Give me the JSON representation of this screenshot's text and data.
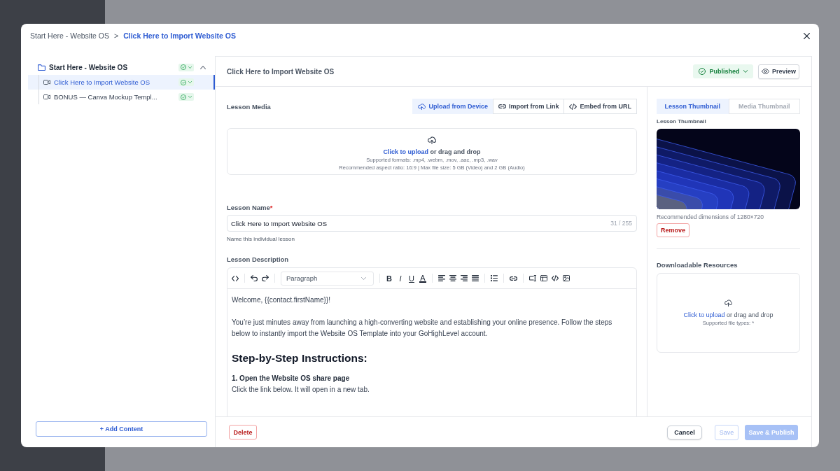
{
  "breadcrumb": {
    "separator": ">",
    "items": [
      {
        "label": "Start Here - Website OS",
        "current": false
      },
      {
        "label": "Click Here to Import Website OS",
        "current": true
      }
    ]
  },
  "sidebar": {
    "items": [
      {
        "label": "Start Here - Website OS",
        "published": true,
        "expanded": true,
        "children": [
          {
            "label": "Click Here to Import Website OS",
            "published": true,
            "selected": true
          },
          {
            "label": "BONUS — Canva Mockup Templ...",
            "published": true,
            "selected": false
          }
        ]
      }
    ],
    "add_button": "+ Add Content"
  },
  "lesson_header": {
    "title": "Click Here to Import Website OS",
    "status": {
      "label": "Published",
      "published": true
    },
    "preview_button": "Preview"
  },
  "media": {
    "label": "Lesson Media",
    "tabs": [
      {
        "kind": "upload",
        "label": "Upload from Device",
        "selected": true
      },
      {
        "kind": "link",
        "label": "Import from Link",
        "selected": false
      },
      {
        "kind": "embed",
        "label": "Embed from URL",
        "selected": false
      }
    ],
    "dropzone": {
      "link": "Click to upload",
      "text": "or drag and drop",
      "formats": "Supported formats: .mp4, .webm, .mov, .aac, .mp3, .wav",
      "limits": "Recommended aspect ratio: 16:9 | Max file size: 5 GB (Video) and 2 GB (Audio)"
    }
  },
  "lesson_name": {
    "label": "Lesson Name",
    "required_mark": "*",
    "value": "Click Here to Import Website OS",
    "counter": "31 / 255",
    "help": "Name this individual lesson"
  },
  "description": {
    "label": "Lesson Description",
    "toolbar": {
      "groups": [
        {
          "items": [
            {
              "kind": "code-view"
            }
          ]
        },
        {
          "items": [
            {
              "kind": "undo"
            },
            {
              "kind": "redo"
            }
          ]
        },
        {
          "items": [
            {
              "kind": "block-format",
              "value": "Paragraph"
            }
          ]
        },
        {
          "items": [
            {
              "kind": "bold",
              "label": "B"
            },
            {
              "kind": "italic",
              "label": "I"
            },
            {
              "kind": "underline",
              "label": "U"
            },
            {
              "kind": "text-color",
              "label": "A"
            }
          ]
        },
        {
          "items": [
            {
              "kind": "align-left"
            },
            {
              "kind": "align-center"
            },
            {
              "kind": "align-right"
            },
            {
              "kind": "align-justify"
            }
          ]
        },
        {
          "items": [
            {
              "kind": "bullet-list"
            }
          ]
        },
        {
          "items": [
            {
              "kind": "link"
            }
          ]
        },
        {
          "items": [
            {
              "kind": "custom-field"
            },
            {
              "kind": "table"
            },
            {
              "kind": "code"
            },
            {
              "kind": "image"
            }
          ]
        }
      ]
    },
    "content": [
      {
        "kind": "paragraph",
        "text": "Welcome, {{contact.firstName}}!"
      },
      {
        "kind": "paragraph",
        "text": "You’re just minutes away from launching a high-converting website and establishing your online presence. Follow the steps below to instantly import the Website OS Template into your GoHighLevel account."
      },
      {
        "kind": "heading",
        "text": "Step-by-Step Instructions:"
      },
      {
        "kind": "step-title",
        "text": "1. Open the Website OS share page"
      },
      {
        "kind": "step-text",
        "text": "Click the link below. It will open in a new tab."
      }
    ]
  },
  "thumbnail": {
    "tabs": [
      {
        "label": "Lesson Thumbnail",
        "selected": true
      },
      {
        "label": "Media Thumbnail",
        "selected": false
      }
    ],
    "label": "Lesson Thumbnail",
    "hint": "Recommended dimensions of 1280×720",
    "remove_button": "Remove"
  },
  "resources": {
    "label": "Downloadable Resources",
    "link": "Click to upload",
    "text": "or drag and drop",
    "hint": "Supported file types: *"
  },
  "footer": {
    "delete_button": "Delete",
    "cancel_button": "Cancel",
    "save_button": {
      "label": "Save",
      "disabled": true
    },
    "publish_button": {
      "label": "Save & Publish",
      "disabled": true
    }
  }
}
